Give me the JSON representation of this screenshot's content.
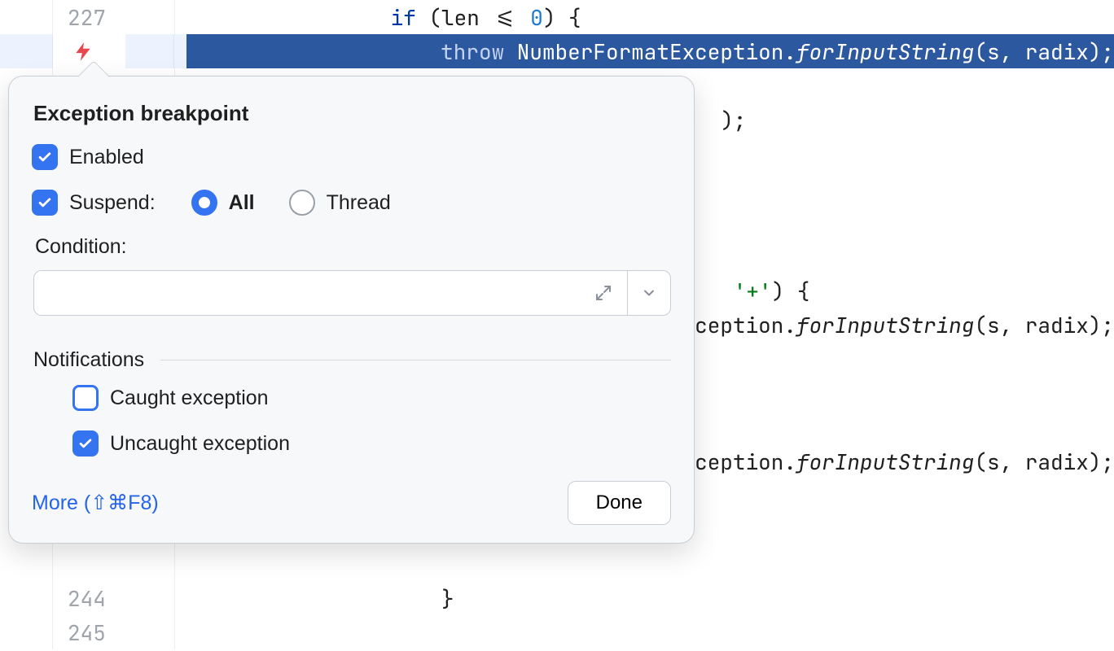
{
  "editor": {
    "lines": [
      {
        "num": "227",
        "hl": false,
        "segs": [
          {
            "cls": "txt",
            "t": "                "
          },
          {
            "cls": "kw",
            "t": "if "
          },
          {
            "cls": "txt",
            "t": "(len <= "
          },
          {
            "cls": "num",
            "t": "0"
          },
          {
            "cls": "txt",
            "t": ") {"
          }
        ]
      },
      {
        "num": "",
        "hl": true,
        "segs": [
          {
            "cls": "wh",
            "t": "                    "
          },
          {
            "cls": "whk",
            "t": "throw "
          },
          {
            "cls": "wh",
            "t": "NumberFormatException."
          },
          {
            "cls": "whm",
            "t": "forInputString"
          },
          {
            "cls": "wh",
            "t": "(s, radix);"
          }
        ]
      },
      {
        "num": "",
        "hl": false,
        "segs": []
      },
      {
        "num": "",
        "hl": false,
        "segs": [
          {
            "cls": "txt",
            "t": "                                          );"
          }
        ]
      },
      {
        "num": "",
        "hl": false,
        "segs": []
      },
      {
        "num": "",
        "hl": false,
        "segs": []
      },
      {
        "num": "",
        "hl": false,
        "segs": []
      },
      {
        "num": "",
        "hl": false,
        "segs": []
      },
      {
        "num": "",
        "hl": false,
        "segs": [
          {
            "cls": "txt",
            "t": "                                           "
          },
          {
            "cls": "chr",
            "t": "'+'"
          },
          {
            "cls": "txt",
            "t": ") {"
          }
        ]
      },
      {
        "num": "",
        "hl": false,
        "segs": [
          {
            "cls": "txt",
            "t": "                                          ‹ception."
          },
          {
            "cls": "mtd",
            "t": "forInputString"
          },
          {
            "cls": "txt",
            "t": "(s, radix);"
          }
        ]
      },
      {
        "num": "",
        "hl": false,
        "segs": []
      },
      {
        "num": "",
        "hl": false,
        "segs": []
      },
      {
        "num": "",
        "hl": false,
        "segs": []
      },
      {
        "num": "",
        "hl": false,
        "segs": [
          {
            "cls": "txt",
            "t": "                                          ‹ception."
          },
          {
            "cls": "mtd",
            "t": "forInputString"
          },
          {
            "cls": "txt",
            "t": "(s, radix);"
          }
        ]
      },
      {
        "num": "",
        "hl": false,
        "segs": []
      },
      {
        "num": "",
        "hl": false,
        "segs": []
      },
      {
        "num": "",
        "hl": false,
        "segs": []
      },
      {
        "num": "244",
        "hl": false,
        "segs": [
          {
            "cls": "txt",
            "t": "                    }"
          }
        ]
      },
      {
        "num": "245",
        "hl": false,
        "segs": []
      }
    ]
  },
  "popover": {
    "title": "Exception breakpoint",
    "enabled_label": "Enabled",
    "suspend_label": "Suspend:",
    "suspend_all": "All",
    "suspend_thread": "Thread",
    "condition_label": "Condition:",
    "condition_value": "",
    "notifications_label": "Notifications",
    "caught_label": "Caught exception",
    "uncaught_label": "Uncaught exception",
    "more_label": "More (⇧⌘F8)",
    "done_label": "Done",
    "state": {
      "enabled": true,
      "suspend_checked": true,
      "suspend_mode": "all",
      "caught": false,
      "uncaught": true
    }
  }
}
